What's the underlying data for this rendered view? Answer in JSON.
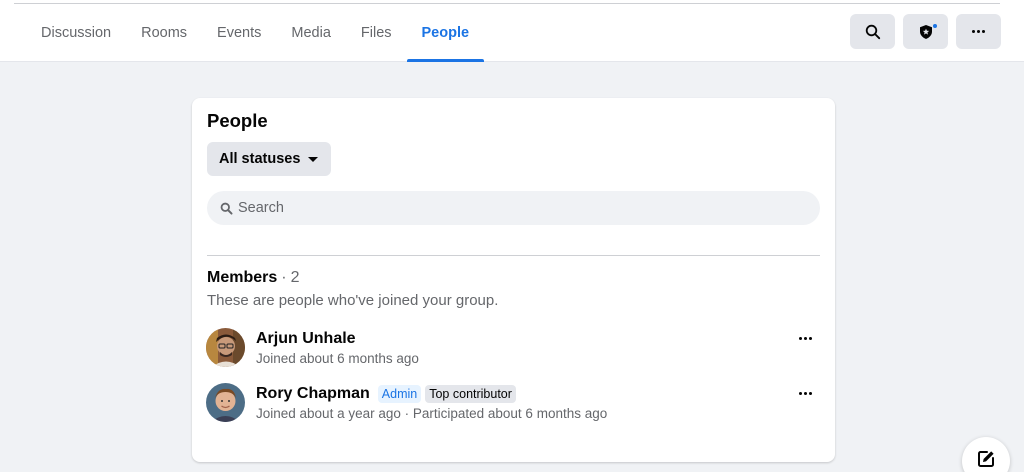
{
  "tabs": [
    {
      "label": "Discussion",
      "active": false
    },
    {
      "label": "Rooms",
      "active": false
    },
    {
      "label": "Events",
      "active": false
    },
    {
      "label": "Media",
      "active": false
    },
    {
      "label": "Files",
      "active": false
    },
    {
      "label": "People",
      "active": true
    }
  ],
  "toolbar": {
    "search_icon": "search-icon",
    "shield_icon": "shield-icon",
    "more_icon": "more-icon",
    "notification_dot_color": "#1b74e4"
  },
  "people": {
    "title": "People",
    "filter_label": "All statuses",
    "search_placeholder": "Search",
    "members_heading": "Members",
    "members_separator": "·",
    "members_count": "2",
    "members_description": "These are people who've joined your group."
  },
  "members": [
    {
      "name": "Arjun Unhale",
      "subtitle": "Joined about 6 months ago",
      "badges": []
    },
    {
      "name": "Rory Chapman",
      "subtitle": "Joined about a year ago · Participated about 6 months ago",
      "badges": [
        "Admin",
        "Top contributor"
      ]
    }
  ],
  "colors": {
    "accent": "#1b74e4",
    "background": "#f0f2f5",
    "secondary_text": "#65676b"
  }
}
